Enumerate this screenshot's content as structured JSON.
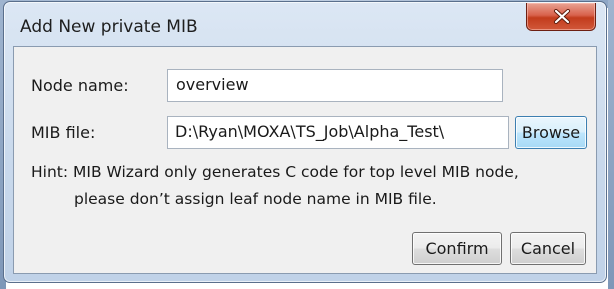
{
  "window": {
    "title": "Add New private MIB",
    "close_icon": "close-icon"
  },
  "form": {
    "node_name_label": "Node name:",
    "node_name_value": "overview",
    "mib_file_label": "MIB file:",
    "mib_file_value": "D:\\Ryan\\MOXA\\TS_Job\\Alpha_Test\\",
    "browse_label": "Browse"
  },
  "hint": {
    "line1": "Hint: MIB Wizard only generates C code for top level MIB node,",
    "line2": "please don’t assign leaf node name in MIB file."
  },
  "buttons": {
    "confirm_label": "Confirm",
    "cancel_label": "Cancel"
  }
}
